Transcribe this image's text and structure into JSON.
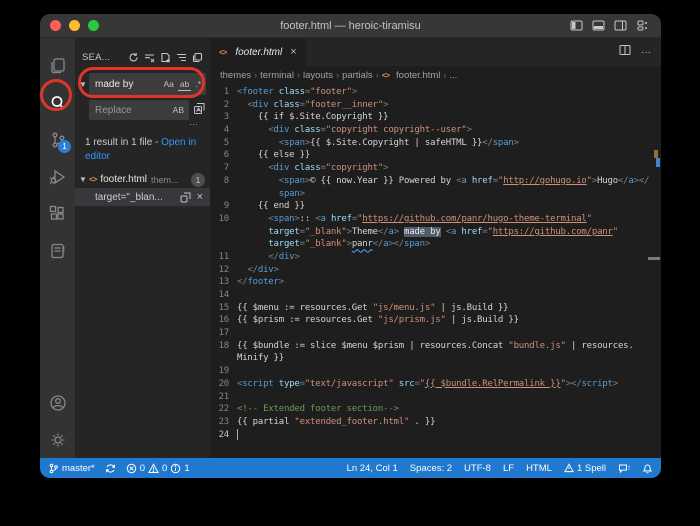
{
  "colors": {
    "annotation_red": "#e1352a",
    "statusbar_blue": "#2078cf",
    "badge_blue": "#2b7fd4",
    "link_blue": "#3794ff",
    "html_icon_orange": "#e8894a",
    "match_highlight": "#515c6a"
  },
  "titlebar": {
    "title": "footer.html — heroic-tiramisu"
  },
  "activity_bar": {
    "scm_badge": "1"
  },
  "sidebar": {
    "header_title": "SEA...",
    "search_input": {
      "value": "made by",
      "match_case": "Aa",
      "whole_word": "ab",
      "regex": ".*"
    },
    "replace_input": {
      "placeholder": "Replace",
      "preserve_case": "AB"
    },
    "toggle_details": "···",
    "results_summary": {
      "prefix": "1 result in 1 file - ",
      "link": "Open in editor"
    },
    "file_result": {
      "name": "footer.html",
      "path": "them...",
      "badge": "1"
    },
    "match_result": {
      "text": "target=\"_blan...",
      "dismiss": "×"
    }
  },
  "editor": {
    "tab": {
      "label": "footer.html",
      "close": "×"
    },
    "actions": {
      "more": "···"
    },
    "breadcrumbs": [
      {
        "label": "themes"
      },
      {
        "label": "terminal"
      },
      {
        "label": "layouts"
      },
      {
        "label": "partials"
      },
      {
        "label": "footer.html",
        "icon": true
      },
      {
        "label": "..."
      }
    ],
    "code_rows": [
      {
        "n": "1",
        "s": [
          [
            "pun",
            "<"
          ],
          [
            "tag",
            "footer"
          ],
          [
            "txt",
            " "
          ],
          [
            "attr",
            "class"
          ],
          [
            "pun",
            "="
          ],
          [
            "str",
            "\"footer\""
          ],
          [
            "pun",
            ">"
          ]
        ]
      },
      {
        "n": "2",
        "s": [
          [
            "txt",
            "  "
          ],
          [
            "pun",
            "<"
          ],
          [
            "tag",
            "div"
          ],
          [
            "txt",
            " "
          ],
          [
            "attr",
            "class"
          ],
          [
            "pun",
            "="
          ],
          [
            "str",
            "\"footer__inner\""
          ],
          [
            "pun",
            ">"
          ]
        ]
      },
      {
        "n": "3",
        "s": [
          [
            "txt",
            "    {{ if $.Site.Copyright }}"
          ]
        ]
      },
      {
        "n": "4",
        "s": [
          [
            "txt",
            "      "
          ],
          [
            "pun",
            "<"
          ],
          [
            "tag",
            "div"
          ],
          [
            "txt",
            " "
          ],
          [
            "attr",
            "class"
          ],
          [
            "pun",
            "="
          ],
          [
            "str",
            "\"copyright copyright--user\""
          ],
          [
            "pun",
            ">"
          ]
        ]
      },
      {
        "n": "5",
        "s": [
          [
            "txt",
            "        "
          ],
          [
            "pun",
            "<"
          ],
          [
            "tag",
            "span"
          ],
          [
            "pun",
            ">"
          ],
          [
            "txt",
            "{{ $.Site.Copyright | safeHTML }}"
          ],
          [
            "pun",
            "</"
          ],
          [
            "tag",
            "span"
          ],
          [
            "pun",
            ">"
          ]
        ]
      },
      {
        "n": "6",
        "s": [
          [
            "txt",
            "    {{ else }}"
          ]
        ]
      },
      {
        "n": "7",
        "s": [
          [
            "txt",
            "      "
          ],
          [
            "pun",
            "<"
          ],
          [
            "tag",
            "div"
          ],
          [
            "txt",
            " "
          ],
          [
            "attr",
            "class"
          ],
          [
            "pun",
            "="
          ],
          [
            "str",
            "\"copyright\""
          ],
          [
            "pun",
            ">"
          ]
        ]
      },
      {
        "n": "8",
        "s": [
          [
            "txt",
            "        "
          ],
          [
            "pun",
            "<"
          ],
          [
            "tag",
            "span"
          ],
          [
            "pun",
            ">"
          ],
          [
            "txt",
            "© {{ now.Year }} Powered by "
          ],
          [
            "pun",
            "<"
          ],
          [
            "tag",
            "a"
          ],
          [
            "txt",
            " "
          ],
          [
            "attr",
            "href"
          ],
          [
            "pun",
            "="
          ],
          [
            "str",
            "\""
          ],
          [
            "lnk",
            "http://gohugo.io"
          ],
          [
            "str",
            "\""
          ],
          [
            "pun",
            ">"
          ],
          [
            "txt",
            "Hugo"
          ],
          [
            "pun",
            "</"
          ],
          [
            "tag",
            "a"
          ],
          [
            "pun",
            "></"
          ]
        ]
      },
      {
        "n": "",
        "s": [
          [
            "txt",
            "        "
          ],
          [
            "tag",
            "span"
          ],
          [
            "pun",
            ">"
          ]
        ]
      },
      {
        "n": "9",
        "s": [
          [
            "txt",
            "    {{ end }}"
          ]
        ]
      },
      {
        "n": "10",
        "s": [
          [
            "txt",
            "      "
          ],
          [
            "pun",
            "<"
          ],
          [
            "tag",
            "span"
          ],
          [
            "pun",
            ">"
          ],
          [
            "txt",
            ":: "
          ],
          [
            "pun",
            "<"
          ],
          [
            "tag",
            "a"
          ],
          [
            "txt",
            " "
          ],
          [
            "attr",
            "href"
          ],
          [
            "pun",
            "="
          ],
          [
            "str",
            "\""
          ],
          [
            "lnk",
            "https://github.com/panr/hugo-theme-terminal"
          ],
          [
            "str",
            "\""
          ]
        ]
      },
      {
        "n": "",
        "s": [
          [
            "txt",
            "      "
          ],
          [
            "attr",
            "target"
          ],
          [
            "pun",
            "="
          ],
          [
            "str",
            "\"_blank\""
          ],
          [
            "pun",
            ">"
          ],
          [
            "txt",
            "Theme"
          ],
          [
            "pun",
            "</"
          ],
          [
            "tag",
            "a"
          ],
          [
            "pun",
            ">"
          ],
          [
            "txt",
            " "
          ],
          [
            "match",
            "made by"
          ],
          [
            "txt",
            " "
          ],
          [
            "pun",
            "<"
          ],
          [
            "tag",
            "a"
          ],
          [
            "txt",
            " "
          ],
          [
            "attr",
            "href"
          ],
          [
            "pun",
            "="
          ],
          [
            "str",
            "\""
          ],
          [
            "lnk",
            "https://github.com/panr"
          ],
          [
            "str",
            "\""
          ]
        ]
      },
      {
        "n": "",
        "s": [
          [
            "txt",
            "      "
          ],
          [
            "attr",
            "target"
          ],
          [
            "pun",
            "="
          ],
          [
            "str",
            "\"_blank\""
          ],
          [
            "pun",
            ">"
          ],
          [
            "spell",
            "panr"
          ],
          [
            "pun",
            "</"
          ],
          [
            "tag",
            "a"
          ],
          [
            "pun",
            "></"
          ],
          [
            "tag",
            "span"
          ],
          [
            "pun",
            ">"
          ]
        ]
      },
      {
        "n": "11",
        "s": [
          [
            "txt",
            "      "
          ],
          [
            "pun",
            "</"
          ],
          [
            "tag",
            "div"
          ],
          [
            "pun",
            ">"
          ]
        ]
      },
      {
        "n": "12",
        "s": [
          [
            "txt",
            "  "
          ],
          [
            "pun",
            "</"
          ],
          [
            "tag",
            "div"
          ],
          [
            "pun",
            ">"
          ]
        ]
      },
      {
        "n": "13",
        "s": [
          [
            "pun",
            "</"
          ],
          [
            "tag",
            "footer"
          ],
          [
            "pun",
            ">"
          ]
        ]
      },
      {
        "n": "14",
        "s": []
      },
      {
        "n": "15",
        "s": [
          [
            "txt",
            "{{ $menu := resources.Get "
          ],
          [
            "str",
            "\"js/menu.js\""
          ],
          [
            "txt",
            " | js.Build }}"
          ]
        ]
      },
      {
        "n": "16",
        "s": [
          [
            "txt",
            "{{ $prism := resources.Get "
          ],
          [
            "str",
            "\"js/prism.js\""
          ],
          [
            "txt",
            " | js.Build }}"
          ]
        ]
      },
      {
        "n": "17",
        "s": []
      },
      {
        "n": "18",
        "s": [
          [
            "txt",
            "{{ $bundle := slice $menu $prism | resources.Concat "
          ],
          [
            "str",
            "\"bundle.js\""
          ],
          [
            "txt",
            " | resources."
          ]
        ]
      },
      {
        "n": "",
        "s": [
          [
            "txt",
            "Minify }}"
          ]
        ]
      },
      {
        "n": "19",
        "s": []
      },
      {
        "n": "20",
        "s": [
          [
            "pun",
            "<"
          ],
          [
            "tag",
            "script"
          ],
          [
            "txt",
            " "
          ],
          [
            "attr",
            "type"
          ],
          [
            "pun",
            "="
          ],
          [
            "str",
            "\"text/javascript\""
          ],
          [
            "txt",
            " "
          ],
          [
            "attr",
            "src"
          ],
          [
            "pun",
            "="
          ],
          [
            "str",
            "\""
          ],
          [
            "lnk",
            "{{ $bundle.RelPermalink }}"
          ],
          [
            "str",
            "\""
          ],
          [
            "pun",
            "></"
          ],
          [
            "tag",
            "script"
          ],
          [
            "pun",
            ">"
          ]
        ]
      },
      {
        "n": "21",
        "s": []
      },
      {
        "n": "22",
        "s": [
          [
            "com",
            "<!-- Extended footer section-->"
          ]
        ]
      },
      {
        "n": "23",
        "s": [
          [
            "txt",
            "{{ partial "
          ],
          [
            "str",
            "\"extended_footer.html\""
          ],
          [
            "txt",
            " . }}"
          ]
        ]
      },
      {
        "n": "24",
        "cursor": true,
        "s": []
      }
    ]
  },
  "status_bar": {
    "branch": "master*",
    "errors": "0",
    "warnings": "0",
    "infos": "1",
    "line_col": "Ln 24, Col 1",
    "indent": "Spaces: 2",
    "encoding": "UTF-8",
    "eol": "LF",
    "language": "HTML",
    "spell": "1 Spell"
  }
}
